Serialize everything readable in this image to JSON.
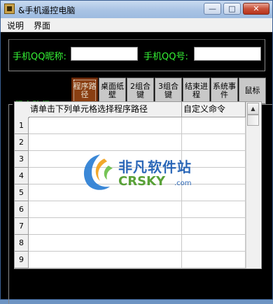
{
  "window": {
    "title": "&手机遥控电脑",
    "min_glyph": "—",
    "max_glyph": "□",
    "close_glyph": "✕"
  },
  "menu": [
    "说明",
    "界面"
  ],
  "form": {
    "qq_nick_label": "手机QQ昵称:",
    "qq_nick_value": "",
    "qq_num_label": "手机QQ号:",
    "qq_num_value": ""
  },
  "tabs": [
    {
      "label": "程序路径",
      "active": true
    },
    {
      "label": "桌面纸壁",
      "active": false
    },
    {
      "label": "2组合键",
      "active": false
    },
    {
      "label": "3组合键",
      "active": false
    },
    {
      "label": "结束进程",
      "active": false
    },
    {
      "label": "系统事件",
      "active": false
    },
    {
      "label": "鼠标",
      "active": false
    }
  ],
  "group_label": "程序路径",
  "grid": {
    "columns": [
      "请单击下列单元格选择程序路径",
      "自定义命令"
    ],
    "row_numbers": [
      "1",
      "2",
      "3",
      "4",
      "5",
      "6",
      "7",
      "8",
      "9"
    ]
  },
  "scrollbar": {
    "up": "▲"
  },
  "watermark": {
    "cn": "非凡软件站",
    "en": "CRSKY",
    "com": ".com"
  },
  "colors": {
    "label_green": "#35f335",
    "active_tab": "#8a3f12",
    "titlebar": "#a9c3e4"
  }
}
